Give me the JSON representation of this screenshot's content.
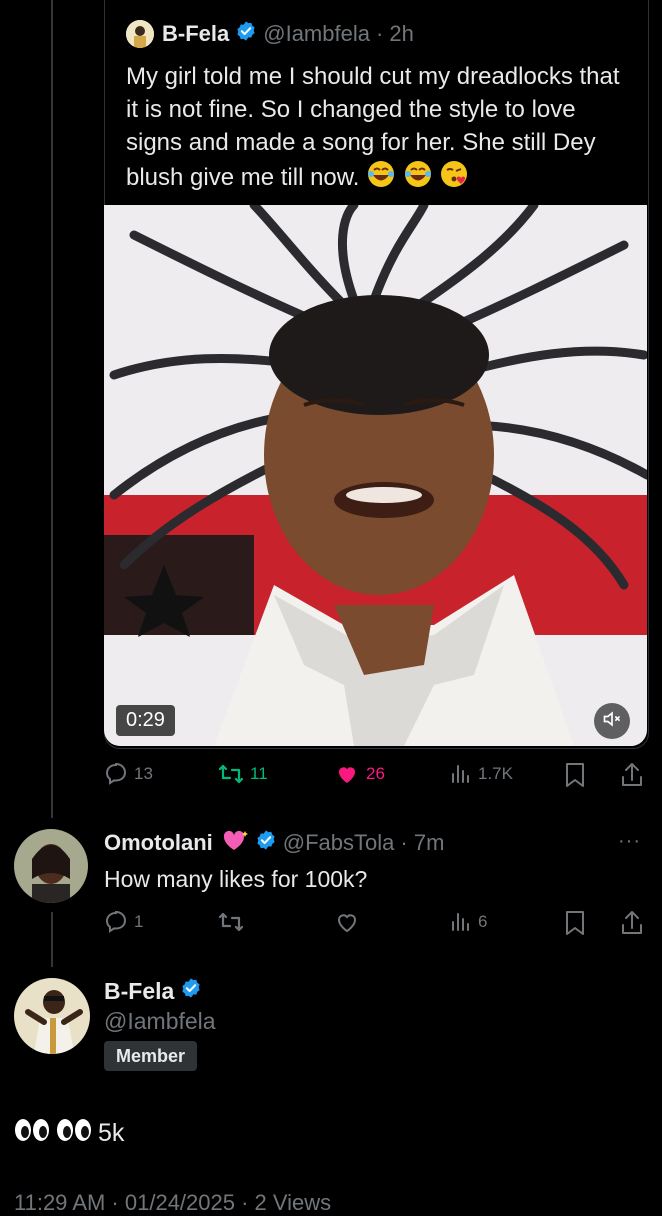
{
  "quoted_tweet": {
    "author_name": "B-Fela",
    "author_handle": "@Iambfela",
    "time": "· 2h",
    "text": "My girl told me I should cut my dreadlocks that it is  not fine. So I  changed the style to love signs and made a song for her. She still Dey blush give me till now.",
    "video_duration": "0:29",
    "actions": {
      "replies": "13",
      "reposts": "11",
      "likes": "26",
      "views": "1.7K"
    }
  },
  "reply": {
    "author_name": "Omotolani",
    "author_handle": "@FabsTola",
    "time": "· 7m",
    "text": "How many likes for 100k?",
    "actions": {
      "replies": "1",
      "views": "6"
    },
    "more_label": "···"
  },
  "composer": {
    "author_name": "B-Fela",
    "author_handle": "@Iambfela",
    "badge": "Member",
    "text": "5k",
    "footer_text": "11:29 AM · 01/24/2025 · 2 Views"
  },
  "colors": {
    "background": "#000000",
    "text": "#e7e9ea",
    "muted": "#71767b",
    "verified": "#1d9bf0",
    "repost_green": "#00ba7c",
    "like_pink": "#f91880"
  },
  "icons": [
    "verified-badge-icon",
    "reply-icon",
    "repost-icon",
    "heart-icon",
    "views-icon",
    "bookmark-icon",
    "share-icon",
    "mute-icon",
    "more-icon"
  ]
}
